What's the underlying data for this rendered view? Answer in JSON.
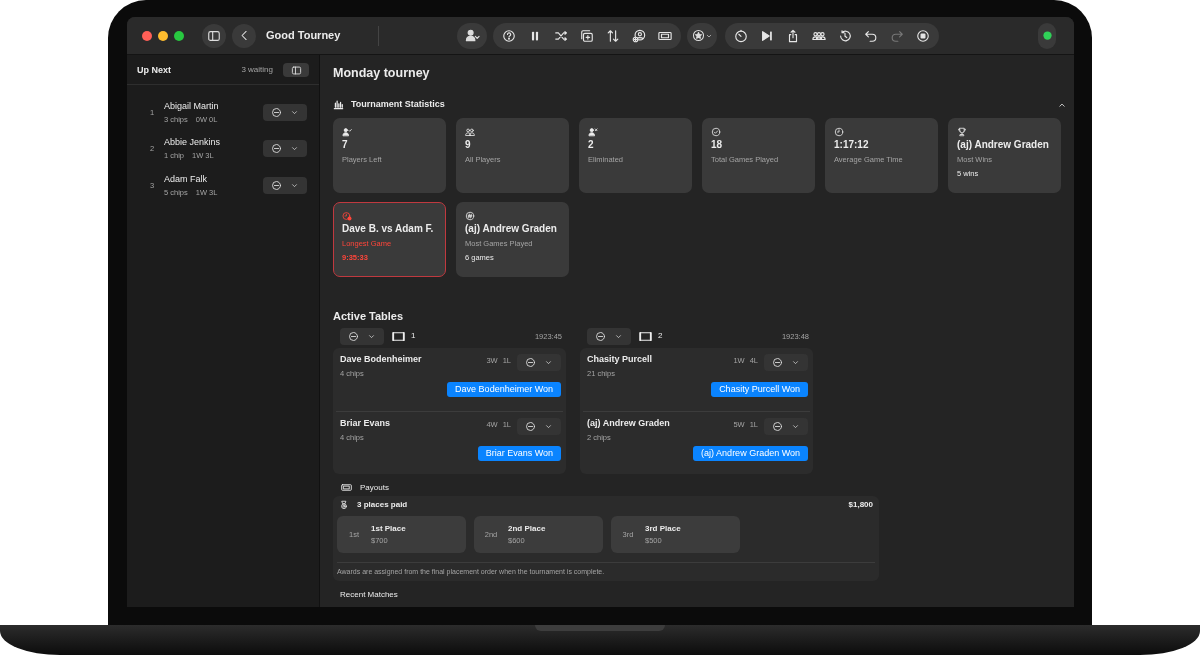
{
  "window": {
    "title": "Good Tourney"
  },
  "sidebar": {
    "title": "Up Next",
    "count": "3 waiting",
    "players": [
      {
        "rank": "1",
        "name": "Abigail Martin",
        "chips": "3 chips",
        "record": "0W 0L"
      },
      {
        "rank": "2",
        "name": "Abbie Jenkins",
        "chips": "1 chip",
        "record": "1W 3L"
      },
      {
        "rank": "3",
        "name": "Adam Falk",
        "chips": "5 chips",
        "record": "1W 3L"
      }
    ]
  },
  "title": "Monday tourney",
  "statistics": {
    "title": "Tournament Statistics",
    "expanded": true,
    "cards": [
      {
        "kind": "person-check",
        "value": "7",
        "label": "Players Left",
        "alert": false
      },
      {
        "kind": "people",
        "value": "9",
        "label": "All Players",
        "alert": false
      },
      {
        "kind": "person-x",
        "value": "2",
        "label": "Eliminated",
        "alert": false
      },
      {
        "kind": "check",
        "value": "18",
        "label": "Total Games Played",
        "alert": false
      },
      {
        "kind": "clock",
        "value": "1:17:12",
        "label": "Average Game Time",
        "alert": false
      },
      {
        "kind": "trophy",
        "value": "(aj) Andrew Graden",
        "label": "Most Wins",
        "note": "5 wins",
        "alert": false
      },
      {
        "kind": "alert-clock",
        "value": "Dave B. vs Adam F.",
        "label": "Longest Game",
        "note": "9:35:33",
        "alert": true
      },
      {
        "kind": "hash",
        "value": "(aj) Andrew Graden",
        "label": "Most Games Played",
        "note": "6 games",
        "alert": false
      }
    ]
  },
  "active_tables": {
    "title": "Active Tables",
    "tables": [
      {
        "number": "1",
        "time": "1923:45",
        "seats": [
          {
            "name": "Dave Bodenheimer",
            "chips": "4 chips",
            "wins": "3W",
            "losses": "1L",
            "button": "Dave Bodenheimer Won"
          },
          {
            "name": "Briar Evans",
            "chips": "4 chips",
            "wins": "4W",
            "losses": "1L",
            "button": "Briar Evans Won"
          }
        ]
      },
      {
        "number": "2",
        "time": "1923:48",
        "seats": [
          {
            "name": "Chasity Purcell",
            "chips": "21 chips",
            "wins": "1W",
            "losses": "4L",
            "button": "Chasity Purcell Won"
          },
          {
            "name": "(aj) Andrew Graden",
            "chips": "2 chips",
            "wins": "5W",
            "losses": "1L",
            "button": "(aj) Andrew Graden Won"
          }
        ]
      }
    ]
  },
  "payouts": {
    "title": "Payouts",
    "summary": "3 places paid",
    "total": "$1,800",
    "places": [
      {
        "ordinal": "1st",
        "name": "1st Place",
        "amount": "$700"
      },
      {
        "ordinal": "2nd",
        "name": "2nd Place",
        "amount": "$600"
      },
      {
        "ordinal": "3rd",
        "name": "3rd Place",
        "amount": "$500"
      }
    ],
    "note": "Awards are assigned from the final placement order when the tournament is complete."
  },
  "recent_matches": {
    "title": "Recent Matches"
  }
}
